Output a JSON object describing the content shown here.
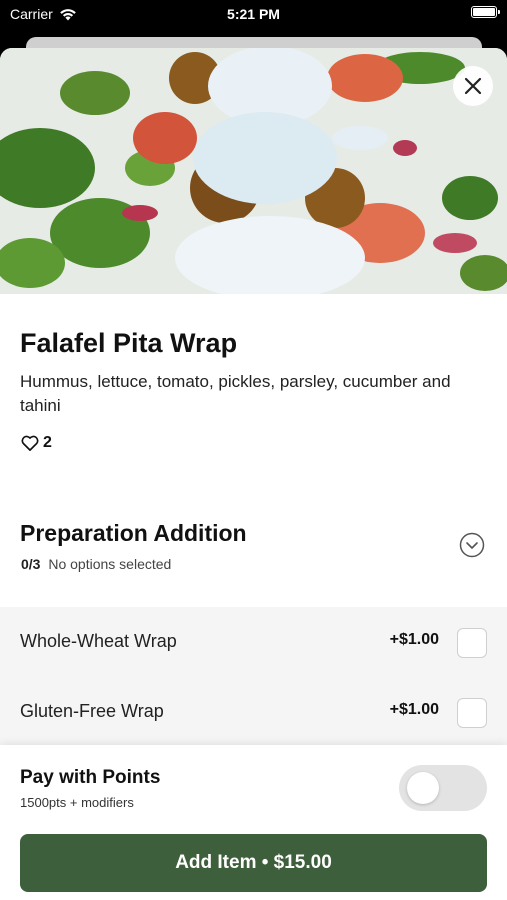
{
  "status_bar": {
    "carrier": "Carrier",
    "time": "5:21 PM"
  },
  "product": {
    "image_alt": "falafel-pita-wrap-photo",
    "name": "Falafel Pita Wrap",
    "description": "Hummus, lettuce, tomato, pickles, parsley, cucumber and tahini",
    "likes": "2"
  },
  "section": {
    "title": "Preparation Addition",
    "selected_count": "0/3",
    "selected_text": "No options selected",
    "options": [
      {
        "label": "Whole-Wheat Wrap",
        "price": "+$1.00",
        "checked": false
      },
      {
        "label": "Gluten-Free Wrap",
        "price": "+$1.00",
        "checked": false
      }
    ]
  },
  "footer": {
    "points_title": "Pay with Points",
    "points_sub": "1500pts + modifiers",
    "points_enabled": false,
    "add_button_label": "Add Item • $15.00"
  },
  "colors": {
    "primary": "#3e5f3b",
    "toggle_off": "#e3e3e3"
  },
  "icons": {
    "close": "close-icon",
    "heart": "heart-icon",
    "chevron": "chevron-down-circle-icon",
    "wifi": "wifi-icon",
    "battery": "battery-icon"
  }
}
